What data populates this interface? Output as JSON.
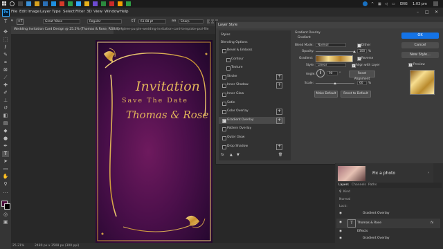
{
  "taskbar": {
    "time": "1:03 pm",
    "language": "ENG",
    "colors": {
      "bar": "#1b1b1b"
    }
  },
  "app": {
    "logo": "Ps",
    "menu": [
      "File",
      "Edit",
      "Image",
      "Layer",
      "Type",
      "Select",
      "Filter",
      "3D",
      "View",
      "Window",
      "Help"
    ]
  },
  "options_bar": {
    "font_family": "Great Vibes",
    "font_style": "Regular",
    "font_size": "61.08 pt",
    "anti_alias": "Sharp"
  },
  "document": {
    "tabs": [
      "Wedding Invitation Card Design @ 25.2% (Thomas & Rose, RGB/8) *",
      "pngtree-purple-wedding-invitation-card-template-psd-file"
    ],
    "status_zoom": "25.21%",
    "status_size": "2480 px x 3508 px (300 ppi)"
  },
  "artboard": {
    "title": "Invitation",
    "subtitle": "Save The Date",
    "names": "Thomas & Rose",
    "colors": {
      "gold": "#e2b65a",
      "purple_center": "#6e1a5e",
      "purple_edge": "#1c0628"
    }
  },
  "dialog": {
    "title": "Layer Style",
    "styles_header": "Styles",
    "blending_options": "Blending Options",
    "style_items": [
      {
        "label": "Bevel & Emboss",
        "checked": false,
        "plus": false
      },
      {
        "label": "Contour",
        "checked": false,
        "plus": false
      },
      {
        "label": "Texture",
        "checked": false,
        "plus": false
      },
      {
        "label": "Stroke",
        "checked": false,
        "plus": true
      },
      {
        "label": "Inner Shadow",
        "checked": false,
        "plus": true
      },
      {
        "label": "Inner Glow",
        "checked": false,
        "plus": false
      },
      {
        "label": "Satin",
        "checked": false,
        "plus": false
      },
      {
        "label": "Color Overlay",
        "checked": false,
        "plus": true
      },
      {
        "label": "Gradient Overlay",
        "checked": true,
        "plus": true
      },
      {
        "label": "Pattern Overlay",
        "checked": false,
        "plus": false
      },
      {
        "label": "Outer Glow",
        "checked": false,
        "plus": false
      },
      {
        "label": "Drop Shadow",
        "checked": false,
        "plus": true
      }
    ],
    "footer_icons": [
      "fx",
      "up",
      "down",
      "trash"
    ],
    "gradient_overlay": {
      "section": "Gradient Overlay",
      "group": "Gradient",
      "blend_mode_label": "Blend Mode:",
      "blend_mode_value": "Normal",
      "dither_label": "Dither",
      "opacity_label": "Opacity:",
      "opacity_value": "100",
      "opacity_unit": "%",
      "gradient_label": "Gradient:",
      "reverse_label": "Reverse",
      "style_label": "Style:",
      "style_value": "Linear",
      "align_label": "Align with Layer",
      "angle_label": "Angle:",
      "angle_value": "90",
      "angle_unit": "°",
      "reset_alignment": "Reset Alignment",
      "scale_label": "Scale:",
      "scale_value": "60",
      "scale_unit": "%",
      "make_default": "Make Default",
      "reset_default": "Reset to Default"
    },
    "buttons": {
      "ok": "OK",
      "cancel": "Cancel",
      "new_style": "New Style...",
      "preview": "Preview"
    }
  },
  "right_panel": {
    "ad_text": "Fix a photo",
    "layer_tabs": [
      "Layers",
      "Channels",
      "Paths"
    ],
    "kind_label": "Kind",
    "blend_label": "Normal",
    "lock_label": "Lock:",
    "layers": [
      {
        "name": "Gradient Overlay",
        "type": "effect"
      },
      {
        "name": "Thomas & Rose",
        "type": "text",
        "fx": "fx"
      },
      {
        "name": "Effects",
        "type": "effect"
      },
      {
        "name": "Gradient Overlay",
        "type": "effect"
      }
    ]
  }
}
